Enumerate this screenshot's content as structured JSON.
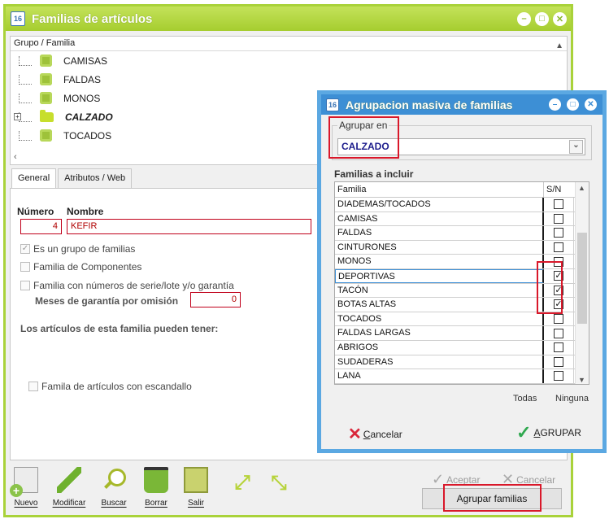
{
  "main": {
    "title": "Familias de artículos",
    "tree_header": "Grupo / Familia",
    "tree_items": [
      {
        "label": "CAMISAS",
        "icon": "puzzle-icon",
        "bold": false
      },
      {
        "label": "FALDAS",
        "icon": "puzzle-icon",
        "bold": false
      },
      {
        "label": "MONOS",
        "icon": "puzzle-icon",
        "bold": false
      },
      {
        "label": "CALZADO",
        "icon": "folder-icon",
        "bold": true
      },
      {
        "label": "TOCADOS",
        "icon": "puzzle-icon",
        "bold": false
      }
    ],
    "tabs": [
      "General",
      "Atributos / Web"
    ],
    "numero_label": "Número",
    "nombre_label": "Nombre",
    "numero_value": "4",
    "nombre_value": "KEFIR",
    "chk_grupo": "Es un grupo de familias",
    "chk_componentes": "Familia de Componentes",
    "chk_serie": "Familia con números de serie/lote y/o garantía",
    "meses_label": "Meses de garantía por omisión",
    "meses_value": "0",
    "pueden_tener": "Los artículos de esta familia pueden tener:",
    "chk_escandallo": "Famila de artículos con escandallo",
    "toolbar": {
      "nuevo": "Nuevo",
      "modificar": "Modificar",
      "buscar": "Buscar",
      "borrar": "Borrar",
      "salir": "Salir"
    },
    "aceptar": "Aceptar",
    "cancelar": "Cancelar",
    "agrupar_familias": "Agrupar familias"
  },
  "dialog": {
    "title": "Agrupacion masiva de familias",
    "agrupar_en_label": "Agrupar en",
    "agrupar_en_value": "CALZADO",
    "familias_label": "Familias a incluir",
    "col_familia": "Familia",
    "col_sn": "S/N",
    "rows": [
      {
        "name": "DIADEMAS/TOCADOS",
        "checked": false
      },
      {
        "name": "CAMISAS",
        "checked": false
      },
      {
        "name": "FALDAS",
        "checked": false
      },
      {
        "name": "CINTURONES",
        "checked": false
      },
      {
        "name": "MONOS",
        "checked": false
      },
      {
        "name": "DEPORTIVAS",
        "checked": true
      },
      {
        "name": "TACÓN",
        "checked": true
      },
      {
        "name": "BOTAS ALTAS",
        "checked": true
      },
      {
        "name": "TOCADOS",
        "checked": false
      },
      {
        "name": "FALDAS LARGAS",
        "checked": false
      },
      {
        "name": "ABRIGOS",
        "checked": false
      },
      {
        "name": "SUDADERAS",
        "checked": false
      },
      {
        "name": "LANA",
        "checked": false
      }
    ],
    "todas": "Todas",
    "ninguna": "Ninguna",
    "cancelar": "Cancelar",
    "agrupar": "AGRUPAR"
  },
  "colors": {
    "main_accent": "#a9d23a",
    "dialog_accent": "#3d8fd5",
    "highlight_red": "#d9182a"
  }
}
